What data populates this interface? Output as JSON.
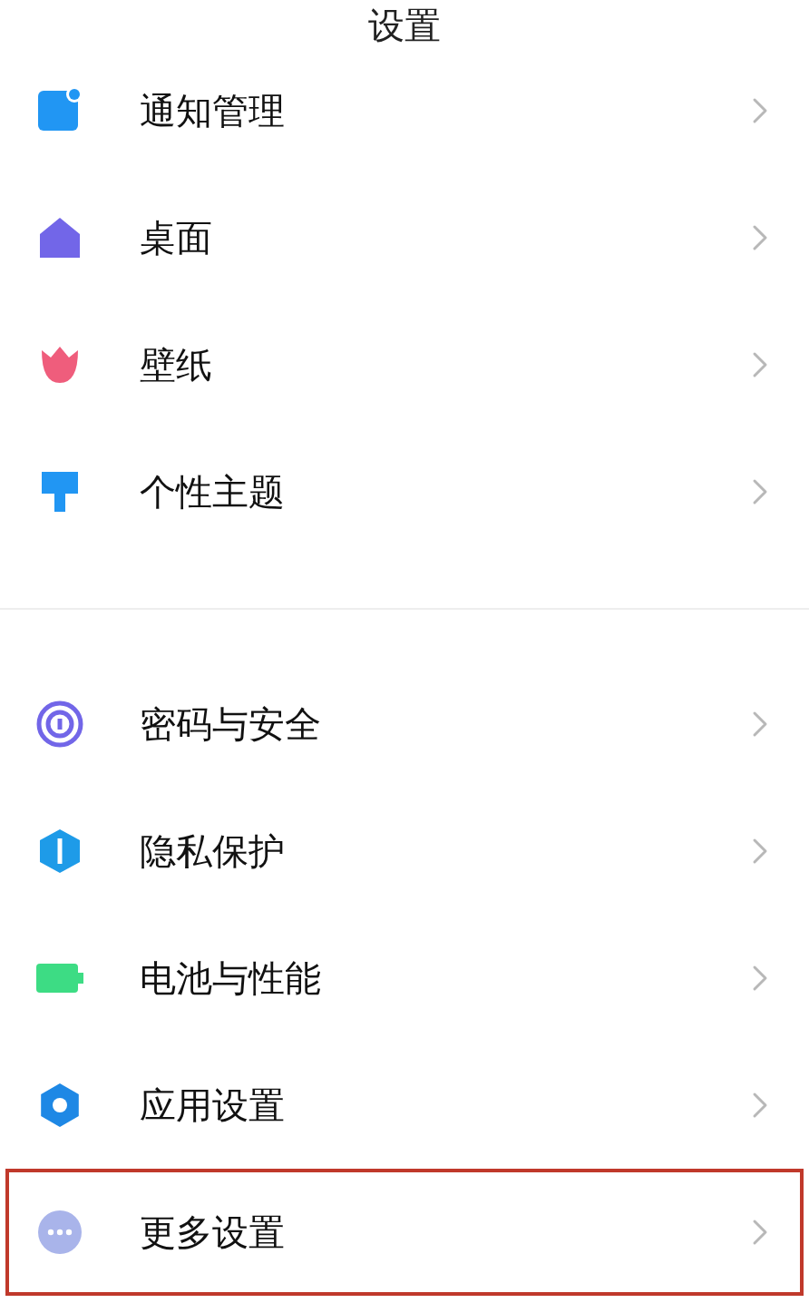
{
  "title": "设置",
  "groups": [
    {
      "items": [
        {
          "label": "通知管理",
          "kind": "notice",
          "highlighted": false
        },
        {
          "label": "桌面",
          "kind": "home",
          "highlighted": false
        },
        {
          "label": "壁纸",
          "kind": "flower",
          "highlighted": false
        },
        {
          "label": "个性主题",
          "kind": "brush",
          "highlighted": false
        }
      ]
    },
    {
      "items": [
        {
          "label": "密码与安全",
          "kind": "rings",
          "highlighted": false
        },
        {
          "label": "隐私保护",
          "kind": "shield",
          "highlighted": false
        },
        {
          "label": "电池与性能",
          "kind": "battery",
          "highlighted": false
        },
        {
          "label": "应用设置",
          "kind": "gear",
          "highlighted": false
        },
        {
          "label": "更多设置",
          "kind": "dots",
          "highlighted": true
        }
      ]
    }
  ]
}
